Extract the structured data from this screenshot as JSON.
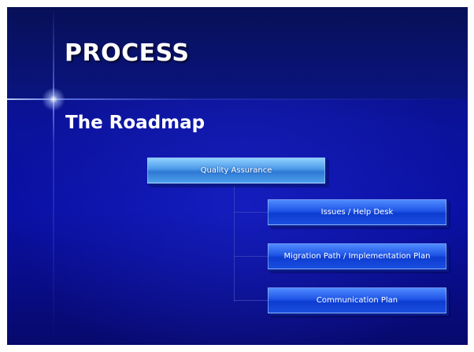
{
  "slide": {
    "title": "PROCESS",
    "subtitle": "The Roadmap"
  },
  "roadmap": {
    "root": {
      "label": "Quality Assurance"
    },
    "items": [
      {
        "label": "Issues / Help Desk"
      },
      {
        "label": "Migration Path / Implementation  Plan"
      },
      {
        "label": "Communication Plan"
      }
    ]
  },
  "colors": {
    "background": "#0a10a5",
    "root_box": "#4a98e8",
    "child_box": "#1f55e6",
    "text": "#ffffff"
  }
}
